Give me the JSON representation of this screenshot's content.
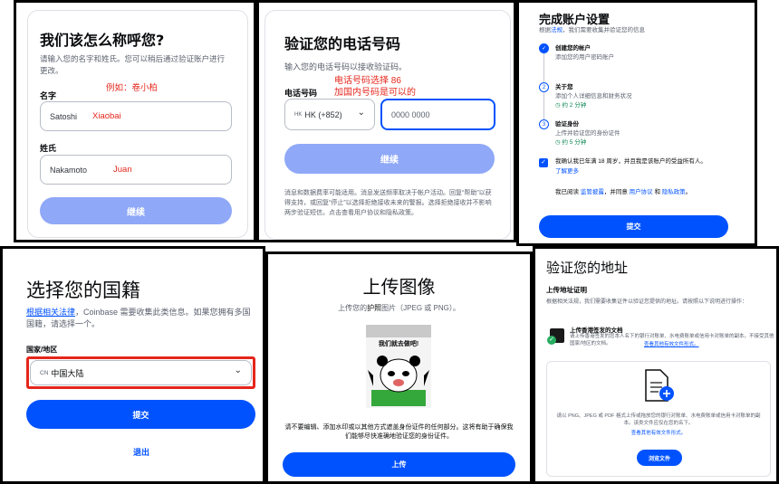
{
  "panel1": {
    "title": "我们该怎么称呼您?",
    "subtitle": "请输入您的名字和姓氏。您可以稍后通过验证账户进行更改。",
    "first_name_label": "名字",
    "example_note": "例如：卷小柏",
    "first_name_value": "Satoshi",
    "first_name_annot": "Xiaobai",
    "last_name_label": "姓氏",
    "last_name_value": "Nakamoto",
    "last_name_annot": "Juan",
    "continue_label": "继续"
  },
  "panel2": {
    "title": "验证您的电话号码",
    "subtitle": "输入您的电话号码以接收验证码。",
    "annot_line1": "电话号码选择 86",
    "annot_line2": "加国内号码是可以的",
    "phone_label": "电话号码",
    "country_code": "HK (+852)",
    "country_flag": "HK",
    "phone_placeholder": "0000 0000",
    "continue_label": "继续",
    "disclaimer": "消息和数据费率可能适用。消息发送频率取决于帐户活动。回复“帮助”以获得支持，或回复“停止”以选择拒绝接收未来的警报。选择拒绝接收并不影响两步验证短信。点击查看用户协议和隐私政策。"
  },
  "panel3": {
    "title": "完成账户设置",
    "intro_prefix": "根据",
    "intro_link": "法规",
    "intro_suffix": "，我们需要收集并验证您的信息",
    "steps": [
      {
        "num": "✓",
        "title": "创建您的帐户",
        "desc": "添加您的用户密码账户",
        "time": ""
      },
      {
        "num": "2",
        "title": "关于您",
        "desc": "添加个人详细信息和财务状况",
        "time": "约 2 分钟"
      },
      {
        "num": "3",
        "title": "验证身份",
        "desc": "上传并验证您的身份证件",
        "time": "约 5 分钟"
      }
    ],
    "confirm_text": "我确认我已年满 18 周岁，并且我是该账户的受益所有人。",
    "learn_more": "了解更多",
    "agree_prefix": "我已阅读",
    "agree_link1": "监管披露",
    "agree_mid1": "，并同意",
    "agree_link2": "用户协议",
    "agree_mid2": "和",
    "agree_link3": "隐私政策",
    "agree_suffix": "。",
    "submit_label": "提交"
  },
  "panel4": {
    "title": "选择您的国籍",
    "desc_link": "根据相关法律",
    "desc_rest": "，Coinbase 需要收集此类信息。如果您拥有多国国籍，请选择一个。",
    "field_label": "国家/地区",
    "country_code": "CN",
    "country_value": "中国大陆",
    "submit_label": "提交",
    "logout_label": "退出"
  },
  "panel5": {
    "title": "上传图像",
    "subtitle_pre": "上传您的",
    "subtitle_mid": "护照",
    "subtitle_post": "图片（JPEG 或 PNG）。",
    "meme_caption": "我们就去做吧!",
    "note": "请不要编辑、添加水印或以其他方式遮盖身份证件的任何部分。这将有助于确保我们能够尽快准确地验证您的身份证件。",
    "upload_label": "上传"
  },
  "panel6": {
    "title": "验证您的地址",
    "section_title": "上传地址证明",
    "section_desc": "根据相关法规，我们需要收集证件以验证您提供的地址。请按照以下说明进行操作：",
    "doc_title": "上传香港签发的文档",
    "doc_desc": "请上传香港签发的您本人名下的银行对账单、水电费账单或信用卡对账单的副本。不接受其他国家/地区的文档。",
    "doc_link": "查看其他有效文件形式。",
    "upload_desc": "请以 PNG、JPEG 或 PDF 格式上传或拖放您的银行对账单、水电费账单或信用卡对账单的副本。该类文件应仅在您的名下。",
    "upload_link": "查看其他有效文件形式。",
    "browse_label": "浏览文件"
  }
}
